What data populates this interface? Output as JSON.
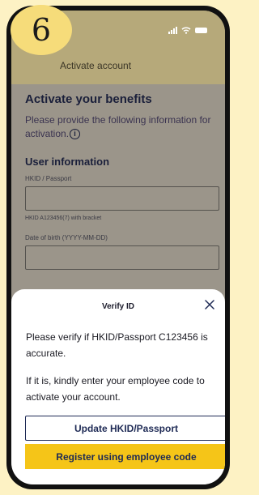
{
  "step_number": "6",
  "header": {
    "title": "Activate account"
  },
  "form": {
    "heading": "Activate your benefits",
    "description": "Please provide the following information for activation.",
    "section_title": "User information",
    "hkid_label": "HKID / Passport",
    "hkid_hint": "HKID A123456(7) with bracket",
    "dob_label": "Date of birth (YYYY-MM-DD)"
  },
  "dialog": {
    "title": "Verify ID",
    "message": "Please verify if HKID/Passport C123456 is accurate.",
    "instruction": "If it is, kindly enter your employee code to activate your account.",
    "update_button": "Update HKID/Passport",
    "register_button": "Register using employee code"
  },
  "colors": {
    "accent_yellow": "#f5c518",
    "navy": "#1e2a55",
    "badge_yellow": "#f6dc7a"
  },
  "icons": {
    "info": "info-circle-icon",
    "close": "close-icon",
    "signal": "signal-icon",
    "wifi": "wifi-icon",
    "battery": "battery-icon"
  }
}
